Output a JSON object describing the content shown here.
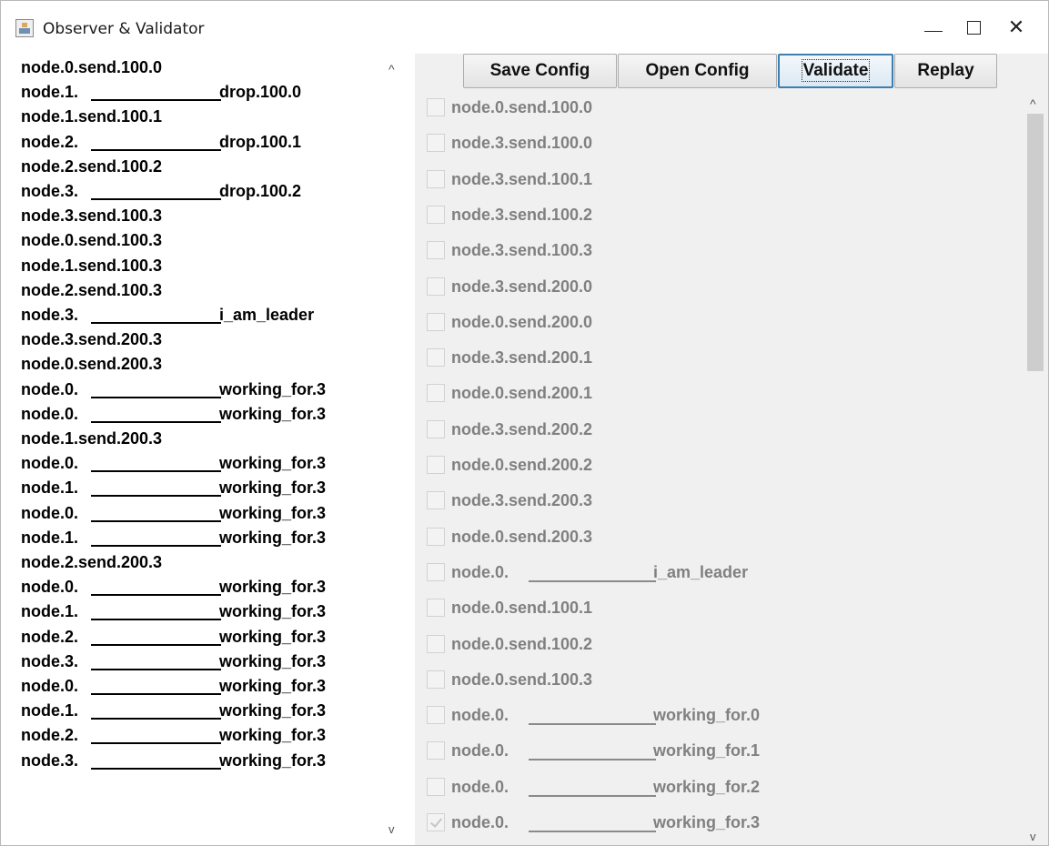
{
  "window": {
    "title": "Observer & Validator",
    "controls": {
      "minimize": "—",
      "maximize": "☐",
      "close": "✕"
    }
  },
  "log": {
    "lines": [
      {
        "prefix": "node.0.send.100.0",
        "suffix": ""
      },
      {
        "prefix": "node.1.",
        "suffix": "drop.100.0",
        "rule": true
      },
      {
        "prefix": "node.1.send.100.1",
        "suffix": ""
      },
      {
        "prefix": "node.2.",
        "suffix": "drop.100.1",
        "rule": true
      },
      {
        "prefix": "node.2.send.100.2",
        "suffix": ""
      },
      {
        "prefix": "node.3.",
        "suffix": "drop.100.2",
        "rule": true
      },
      {
        "prefix": "node.3.send.100.3",
        "suffix": ""
      },
      {
        "prefix": "node.0.send.100.3",
        "suffix": ""
      },
      {
        "prefix": "node.1.send.100.3",
        "suffix": ""
      },
      {
        "prefix": "node.2.send.100.3",
        "suffix": ""
      },
      {
        "prefix": "node.3.",
        "suffix": "i_am_leader",
        "rule": true
      },
      {
        "prefix": "node.3.send.200.3",
        "suffix": ""
      },
      {
        "prefix": "node.0.send.200.3",
        "suffix": ""
      },
      {
        "prefix": "node.0.",
        "suffix": "working_for.3",
        "rule": true
      },
      {
        "prefix": "node.0.",
        "suffix": "working_for.3",
        "rule": true
      },
      {
        "prefix": "node.1.send.200.3",
        "suffix": ""
      },
      {
        "prefix": "node.0.",
        "suffix": "working_for.3",
        "rule": true
      },
      {
        "prefix": "node.1.",
        "suffix": "working_for.3",
        "rule": true
      },
      {
        "prefix": "node.0.",
        "suffix": "working_for.3",
        "rule": true
      },
      {
        "prefix": "node.1.",
        "suffix": "working_for.3",
        "rule": true
      },
      {
        "prefix": "node.2.send.200.3",
        "suffix": ""
      },
      {
        "prefix": "node.0.",
        "suffix": "working_for.3",
        "rule": true
      },
      {
        "prefix": "node.1.",
        "suffix": "working_for.3",
        "rule": true
      },
      {
        "prefix": "node.2.",
        "suffix": "working_for.3",
        "rule": true
      },
      {
        "prefix": "node.3.",
        "suffix": "working_for.3",
        "rule": true
      },
      {
        "prefix": "node.0.",
        "suffix": "working_for.3",
        "rule": true
      },
      {
        "prefix": "node.1.",
        "suffix": "working_for.3",
        "rule": true
      },
      {
        "prefix": "node.2.",
        "suffix": "working_for.3",
        "rule": true
      },
      {
        "prefix": "node.3.",
        "suffix": "working_for.3",
        "rule": true
      }
    ],
    "scroll_up": "^",
    "scroll_down": "v"
  },
  "toolbar": {
    "save_config": "Save Config",
    "open_config": "Open Config",
    "validate": "Validate",
    "replay": "Replay"
  },
  "checklist": {
    "items": [
      {
        "prefix": "node.0.send.100.0",
        "suffix": "",
        "checked": false
      },
      {
        "prefix": "node.3.send.100.0",
        "suffix": "",
        "checked": false
      },
      {
        "prefix": "node.3.send.100.1",
        "suffix": "",
        "checked": false
      },
      {
        "prefix": "node.3.send.100.2",
        "suffix": "",
        "checked": false
      },
      {
        "prefix": "node.3.send.100.3",
        "suffix": "",
        "checked": false
      },
      {
        "prefix": "node.3.send.200.0",
        "suffix": "",
        "checked": false
      },
      {
        "prefix": "node.0.send.200.0",
        "suffix": "",
        "checked": false
      },
      {
        "prefix": "node.3.send.200.1",
        "suffix": "",
        "checked": false
      },
      {
        "prefix": "node.0.send.200.1",
        "suffix": "",
        "checked": false
      },
      {
        "prefix": "node.3.send.200.2",
        "suffix": "",
        "checked": false
      },
      {
        "prefix": "node.0.send.200.2",
        "suffix": "",
        "checked": false
      },
      {
        "prefix": "node.3.send.200.3",
        "suffix": "",
        "checked": false
      },
      {
        "prefix": "node.0.send.200.3",
        "suffix": "",
        "checked": false
      },
      {
        "prefix": "node.0.",
        "suffix": "i_am_leader",
        "rule": true,
        "checked": false
      },
      {
        "prefix": "node.0.send.100.1",
        "suffix": "",
        "checked": false
      },
      {
        "prefix": "node.0.send.100.2",
        "suffix": "",
        "checked": false
      },
      {
        "prefix": "node.0.send.100.3",
        "suffix": "",
        "checked": false
      },
      {
        "prefix": "node.0.",
        "suffix": "working_for.0",
        "rule": true,
        "checked": false
      },
      {
        "prefix": "node.0.",
        "suffix": "working_for.1",
        "rule": true,
        "checked": false
      },
      {
        "prefix": "node.0.",
        "suffix": "working_for.2",
        "rule": true,
        "checked": false
      },
      {
        "prefix": "node.0.",
        "suffix": "working_for.3",
        "rule": true,
        "checked": true
      }
    ],
    "scroll_up": "^",
    "scroll_down": "v"
  },
  "colors": {
    "focus_border": "#3c7fb1",
    "disabled_text": "#808080",
    "panel_bg": "#f0f0f0"
  }
}
